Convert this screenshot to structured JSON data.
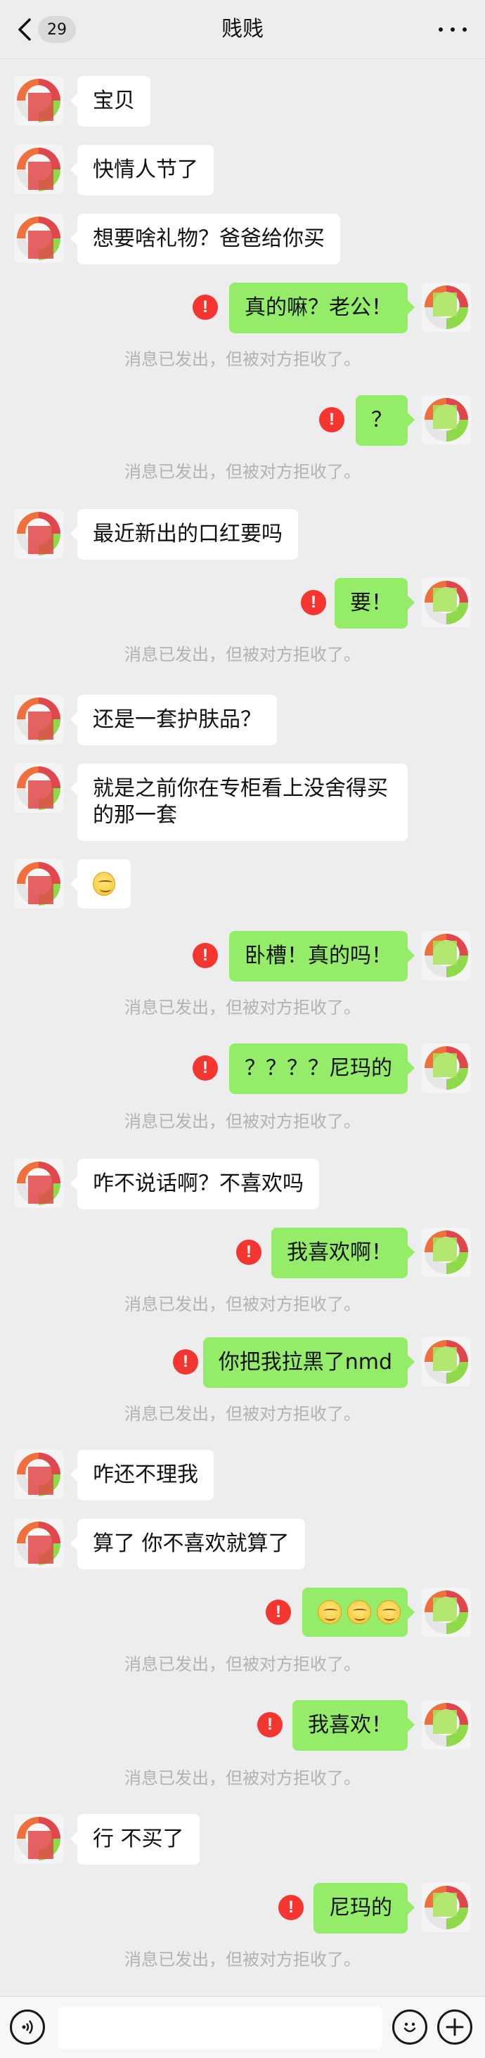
{
  "header": {
    "back_count": "29",
    "title": "贱贱"
  },
  "system": {
    "rejected": "消息已发出，但被对方拒收了。",
    "fail_mark": "!"
  },
  "messages": [
    {
      "text": "宝贝"
    },
    {
      "text": "快情人节了"
    },
    {
      "text": "想要啥礼物？爸爸给你买"
    },
    {
      "text": "真的嘛？老公！"
    },
    {
      "text": "？"
    },
    {
      "text": "最近新出的口红要吗"
    },
    {
      "text": "要！"
    },
    {
      "text": "还是一套护肤品？"
    },
    {
      "text": "就是之前你在专柜看上没舍得买\n的那一套"
    },
    {
      "text": "",
      "icon": "thinking-emoji"
    },
    {
      "text": "卧槽！真的吗！"
    },
    {
      "text": "？？？？尼玛的"
    },
    {
      "text": "咋不说话啊？不喜欢吗"
    },
    {
      "text": "我喜欢啊！"
    },
    {
      "text": "你把我拉黑了nmd"
    },
    {
      "text": "咋还不理我"
    },
    {
      "text": "算了 你不喜欢就算了"
    },
    {
      "text": "",
      "icon": "smile-emoji-x3"
    },
    {
      "text": "我喜欢！"
    },
    {
      "text": "行 不买了"
    },
    {
      "text": "尼玛的"
    }
  ],
  "footer": {
    "voice_icon": "voice-icon",
    "emoji_icon": "emoji-icon",
    "plus_icon": "plus-icon"
  },
  "colors": {
    "background": "#ededed",
    "incoming_bubble": "#ffffff",
    "outgoing_bubble": "#95ec69",
    "fail": "#f43530",
    "system_text": "#b2b2b2"
  }
}
